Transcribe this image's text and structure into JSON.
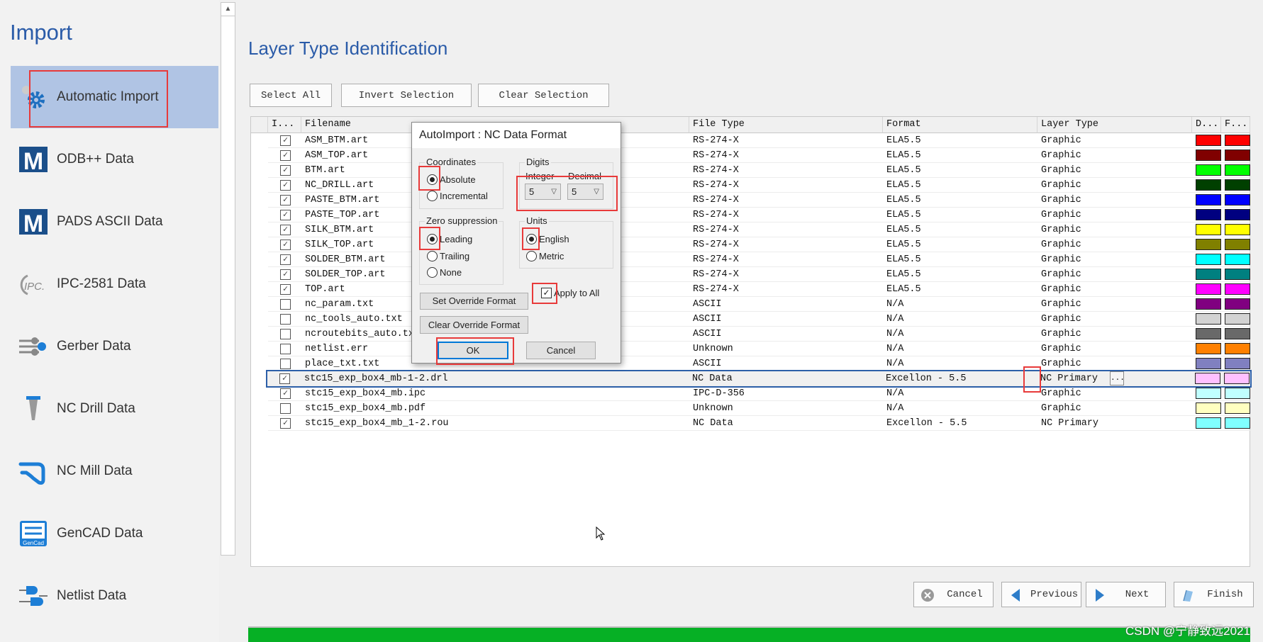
{
  "sidebar": {
    "title": "Import",
    "items": [
      {
        "label": "Automatic Import",
        "icon": "gear-icon",
        "selected": true
      },
      {
        "label": "ODB++ Data",
        "icon": "mentor-m-icon"
      },
      {
        "label": "PADS ASCII Data",
        "icon": "mentor-m-icon"
      },
      {
        "label": "IPC-2581 Data",
        "icon": "ipc-logo-icon"
      },
      {
        "label": "Gerber Data",
        "icon": "gerber-icon"
      },
      {
        "label": "NC Drill Data",
        "icon": "drill-bit-icon"
      },
      {
        "label": "NC Mill Data",
        "icon": "mill-path-icon"
      },
      {
        "label": "GenCAD Data",
        "icon": "gencad-icon"
      },
      {
        "label": "Netlist Data",
        "icon": "netlist-icon"
      }
    ]
  },
  "main": {
    "title": "Layer Type Identification",
    "toolbar": {
      "select_all": "Select All",
      "invert": "Invert Selection",
      "clear": "Clear Selection"
    },
    "columns": [
      "I...",
      "Filename",
      "File Type",
      "Format",
      "Layer Type",
      "D...",
      "F..."
    ],
    "rows": [
      {
        "checked": true,
        "filename": "ASM_BTM.art",
        "file_type": "RS-274-X",
        "format": "ELA5.5",
        "layer_type": "Graphic",
        "color": "#FF0000"
      },
      {
        "checked": true,
        "filename": "ASM_TOP.art",
        "file_type": "RS-274-X",
        "format": "ELA5.5",
        "layer_type": "Graphic",
        "color": "#800000"
      },
      {
        "checked": true,
        "filename": "BTM.art",
        "file_type": "RS-274-X",
        "format": "ELA5.5",
        "layer_type": "Graphic",
        "color": "#00FF00"
      },
      {
        "checked": true,
        "filename": "NC_DRILL.art",
        "file_type": "RS-274-X",
        "format": "ELA5.5",
        "layer_type": "Graphic",
        "color": "#004000"
      },
      {
        "checked": true,
        "filename": "PASTE_BTM.art",
        "file_type": "RS-274-X",
        "format": "ELA5.5",
        "layer_type": "Graphic",
        "color": "#0000FF"
      },
      {
        "checked": true,
        "filename": "PASTE_TOP.art",
        "file_type": "RS-274-X",
        "format": "ELA5.5",
        "layer_type": "Graphic",
        "color": "#000080"
      },
      {
        "checked": true,
        "filename": "SILK_BTM.art",
        "file_type": "RS-274-X",
        "format": "ELA5.5",
        "layer_type": "Graphic",
        "color": "#FFFF00"
      },
      {
        "checked": true,
        "filename": "SILK_TOP.art",
        "file_type": "RS-274-X",
        "format": "ELA5.5",
        "layer_type": "Graphic",
        "color": "#808000"
      },
      {
        "checked": true,
        "filename": "SOLDER_BTM.art",
        "file_type": "RS-274-X",
        "format": "ELA5.5",
        "layer_type": "Graphic",
        "color": "#00FFFF"
      },
      {
        "checked": true,
        "filename": "SOLDER_TOP.art",
        "file_type": "RS-274-X",
        "format": "ELA5.5",
        "layer_type": "Graphic",
        "color": "#008080"
      },
      {
        "checked": true,
        "filename": "TOP.art",
        "file_type": "RS-274-X",
        "format": "ELA5.5",
        "layer_type": "Graphic",
        "color": "#FF00FF"
      },
      {
        "checked": false,
        "filename": "nc_param.txt",
        "file_type": "ASCII",
        "format": "N/A",
        "layer_type": "Graphic",
        "color": "#800080"
      },
      {
        "checked": false,
        "filename": "nc_tools_auto.txt",
        "file_type": "ASCII",
        "format": "N/A",
        "layer_type": "Graphic",
        "color": "#D3D3D3"
      },
      {
        "checked": false,
        "filename": "ncroutebits_auto.txt",
        "file_type": "ASCII",
        "format": "N/A",
        "layer_type": "Graphic",
        "color": "#696969"
      },
      {
        "checked": false,
        "filename": "netlist.err",
        "file_type": "Unknown",
        "format": "N/A",
        "layer_type": "Graphic",
        "color": "#FF8000"
      },
      {
        "checked": false,
        "filename": "place_txt.txt",
        "file_type": "ASCII",
        "format": "N/A",
        "layer_type": "Graphic",
        "color": "#8080C0"
      },
      {
        "checked": true,
        "filename": "stc15_exp_box4_mb-1-2.drl",
        "file_type": "NC Data",
        "format": "Excellon - 5.5",
        "layer_type": "NC Primary",
        "color": "#FFC0FF",
        "selected": true,
        "has_dots": true
      },
      {
        "checked": true,
        "filename": "stc15_exp_box4_mb.ipc",
        "file_type": "IPC-D-356",
        "format": "N/A",
        "layer_type": "Graphic",
        "color": "#C0FFFF"
      },
      {
        "checked": false,
        "filename": "stc15_exp_box4_mb.pdf",
        "file_type": "Unknown",
        "format": "N/A",
        "layer_type": "Graphic",
        "color": "#FFFFC0"
      },
      {
        "checked": true,
        "filename": "stc15_exp_box4_mb_1-2.rou",
        "file_type": "NC Data",
        "format": "Excellon - 5.5",
        "layer_type": "NC Primary",
        "color": "#80FFFF"
      }
    ],
    "dots_label": "..."
  },
  "footer": {
    "cancel": "Cancel",
    "previous": "Previous",
    "next": "Next",
    "finish": "Finish",
    "progress_percent": 100,
    "watermark": "CSDN @宁静致远2021"
  },
  "dialog": {
    "title": "AutoImport : NC Data Format",
    "coordinates": {
      "label": "Coordinates",
      "options": [
        "Absolute",
        "Incremental"
      ],
      "selected": "Absolute"
    },
    "digits": {
      "label": "Digits",
      "integer_label": "Integer",
      "decimal_label": "Decimal",
      "integer": "5",
      "decimal": "5"
    },
    "zero_suppression": {
      "label": "Zero suppression",
      "options": [
        "Leading",
        "Trailing",
        "None"
      ],
      "selected": "Leading"
    },
    "units": {
      "label": "Units",
      "options": [
        "English",
        "Metric"
      ],
      "selected": "English"
    },
    "apply_to_all": {
      "label": "Apply to All",
      "checked": true
    },
    "set_override": "Set Override Format",
    "clear_override": "Clear Override Format",
    "ok": "OK",
    "cancel": "Cancel"
  },
  "colors": {
    "accent": "#2a5ba8",
    "selection": "#b0c4e4",
    "highlight": "#e83a3a",
    "progress": "#06b025"
  }
}
